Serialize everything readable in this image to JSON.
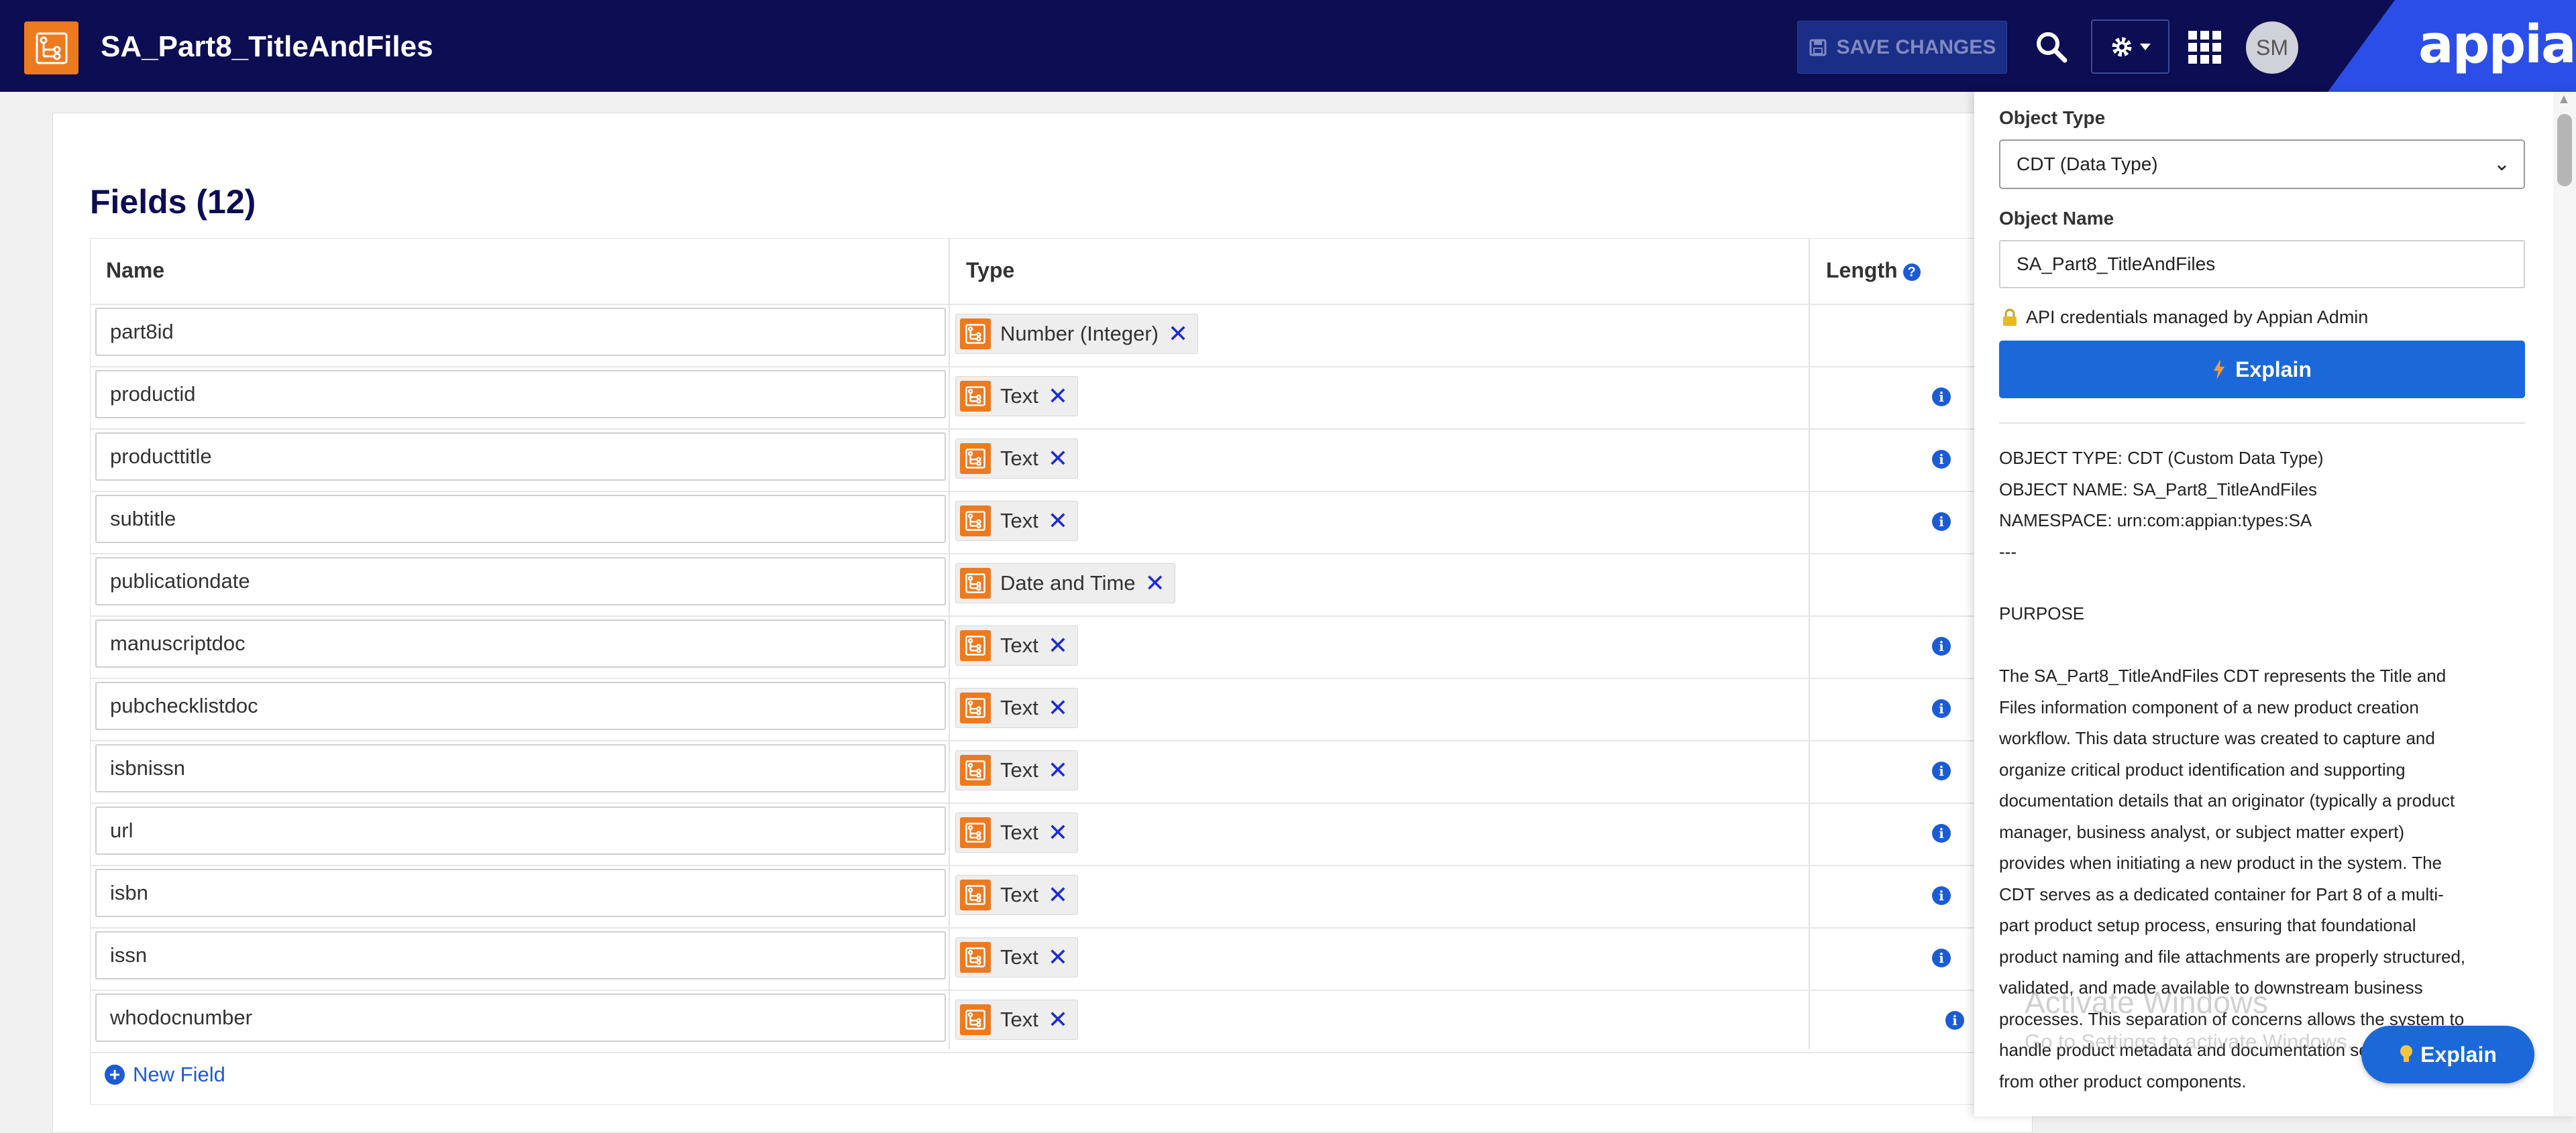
{
  "header": {
    "title": "SA_Part8_TitleAndFiles",
    "save_label": "SAVE CHANGES",
    "avatar_initials": "SM",
    "brand": "appian",
    "accent_color": "#0c0d52",
    "brand_color": "#2b4ee8",
    "app_icon_color": "#ee7a1f"
  },
  "fields": {
    "title": "Fields (12)",
    "columns": {
      "name": "Name",
      "type": "Type",
      "length": "Length"
    },
    "rows": [
      {
        "name": "part8id",
        "type": "Number (Integer)",
        "info": false
      },
      {
        "name": "productid",
        "type": "Text",
        "info": true
      },
      {
        "name": "producttitle",
        "type": "Text",
        "info": true
      },
      {
        "name": "subtitle",
        "type": "Text",
        "info": true
      },
      {
        "name": "publicationdate",
        "type": "Date and Time",
        "info": false
      },
      {
        "name": "manuscriptdoc",
        "type": "Text",
        "info": true
      },
      {
        "name": "pubchecklistdoc",
        "type": "Text",
        "info": true
      },
      {
        "name": "isbnissn",
        "type": "Text",
        "info": true
      },
      {
        "name": "url",
        "type": "Text",
        "info": true
      },
      {
        "name": "isbn",
        "type": "Text",
        "info": true
      },
      {
        "name": "issn",
        "type": "Text",
        "info": true
      },
      {
        "name": "whodocnumber",
        "type": "Text",
        "info": true
      }
    ],
    "new_field_label": "New Field"
  },
  "panel": {
    "object_type_label": "Object Type",
    "object_type_value": "CDT (Data Type)",
    "object_name_label": "Object Name",
    "object_name_value": "SA_Part8_TitleAndFiles",
    "api_note": "API credentials managed by Appian Admin",
    "explain_label": "Explain",
    "info": [
      "OBJECT TYPE: CDT (Custom Data Type)",
      "OBJECT NAME: SA_Part8_TitleAndFiles",
      "NAMESPACE: urn:com:appian:types:SA",
      "---"
    ],
    "purpose_heading": "PURPOSE",
    "purpose_lines": [
      "The SA_Part8_TitleAndFiles CDT represents the Title and",
      "Files information component of a new product creation",
      "workflow. This data structure was created to capture and",
      "organize critical product identification and supporting",
      "documentation details that an originator (typically a product",
      "manager, business analyst, or subject matter expert)",
      "provides when initiating a new product in the system. The",
      "CDT serves as a dedicated container for Part 8 of a multi-",
      "part product setup process, ensuring that foundational",
      "product naming and file attachments are properly structured,",
      "validated, and made available to downstream business",
      "processes. This separation of concerns allows the system to",
      "handle product metadata and documentation separately",
      "from other product components."
    ],
    "floating_explain_label": "Explain",
    "watermark_title": "Activate Windows",
    "watermark_sub": "Go to Settings to activate Windows."
  }
}
